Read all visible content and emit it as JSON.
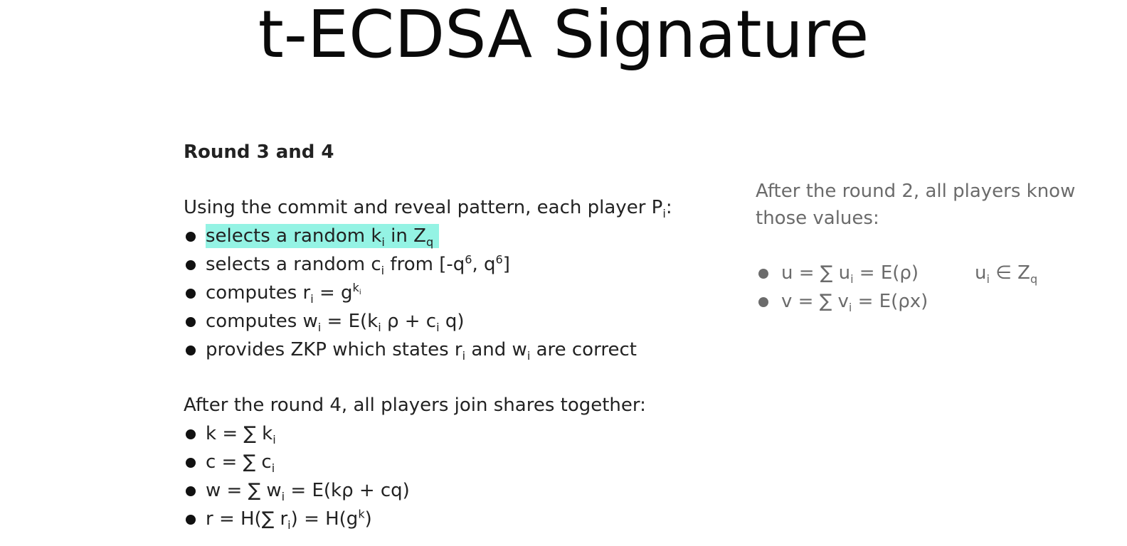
{
  "title": "t-ECDSA Signature",
  "left": {
    "heading": "Round 3 and 4",
    "intro": {
      "text": "Using the commit and reveal pattern, each player P",
      "sub": "i",
      "tail": ":"
    },
    "steps": [
      {
        "a": "selects a random k",
        "a_sub": "i",
        "b": " in Z",
        "b_sub": "q"
      },
      {
        "a": "selects a random c",
        "a_sub": "i",
        "b": " from [-q",
        "b_sup": "6",
        "c": ", q",
        "c_sup": "6",
        "d": "]"
      },
      {
        "a": "computes r",
        "a_sub": "i",
        "b": " = g",
        "b_sup": "k",
        "b_supsub": "i"
      },
      {
        "a": "computes w",
        "a_sub": "i",
        "b": " = E(k",
        "b_sub": "i",
        "c": " ρ + c",
        "c_sub": "i",
        "d": " q)"
      },
      {
        "a": "provides ZKP which states r",
        "a_sub": "i",
        "b": " and w",
        "b_sub": "i",
        "c": " are correct"
      }
    ],
    "after": "After the round 4, all players join shares together:",
    "results": [
      {
        "a": "k = ∑ k",
        "a_sub": "i"
      },
      {
        "a": "c = ∑ c",
        "a_sub": "i"
      },
      {
        "a": "w = ∑ w",
        "a_sub": "i",
        "b": " = E(kρ + cq)"
      },
      {
        "a": "r = H(∑ r",
        "a_sub": "i",
        "b": ") = H(g",
        "b_sup": "k",
        "c": ")"
      }
    ]
  },
  "right": {
    "intro": "After the round 2, all players know those values:",
    "items": [
      {
        "a": "u = ∑ u",
        "a_sub": "i",
        "b": " = E(ρ)",
        "note": "u",
        "note_sub": "i",
        "note_b": " ∈ Z",
        "note_sub2": "q"
      },
      {
        "a": "v = ∑ v",
        "a_sub": "i",
        "b": " = E(ρx)"
      }
    ]
  },
  "colors": {
    "highlight": "#94f3e4",
    "muted_text": "#6b6b6b",
    "text": "#222222"
  }
}
